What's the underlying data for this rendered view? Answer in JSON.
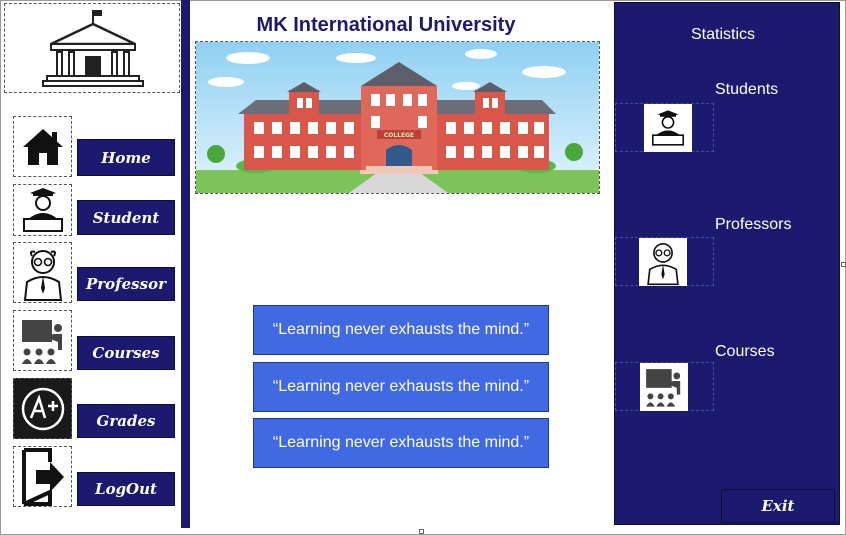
{
  "app": {
    "title": "MK International University"
  },
  "sidebar": {
    "items": [
      {
        "label": "Home",
        "icon": "home-icon"
      },
      {
        "label": "Student",
        "icon": "student-icon"
      },
      {
        "label": "Professor",
        "icon": "professor-icon"
      },
      {
        "label": "Courses",
        "icon": "courses-icon"
      },
      {
        "label": "Grades",
        "icon": "grades-icon"
      },
      {
        "label": "LogOut",
        "icon": "logout-icon"
      }
    ]
  },
  "hero": {
    "sign": "COLLEGE"
  },
  "quotes": [
    "“Learning never exhausts the mind.”",
    "“Learning never exhausts the mind.”",
    "“Learning never exhausts the mind.”"
  ],
  "stats": {
    "title": "Statistics",
    "items": [
      {
        "label": "Students",
        "icon": "student-icon"
      },
      {
        "label": "Professors",
        "icon": "professor-icon"
      },
      {
        "label": "Courses",
        "icon": "courses-icon"
      }
    ]
  },
  "exit_label": "Exit",
  "colors": {
    "navy": "#1c1a6f",
    "quote_blue": "#4169e1",
    "building_red": "#d9574a"
  }
}
